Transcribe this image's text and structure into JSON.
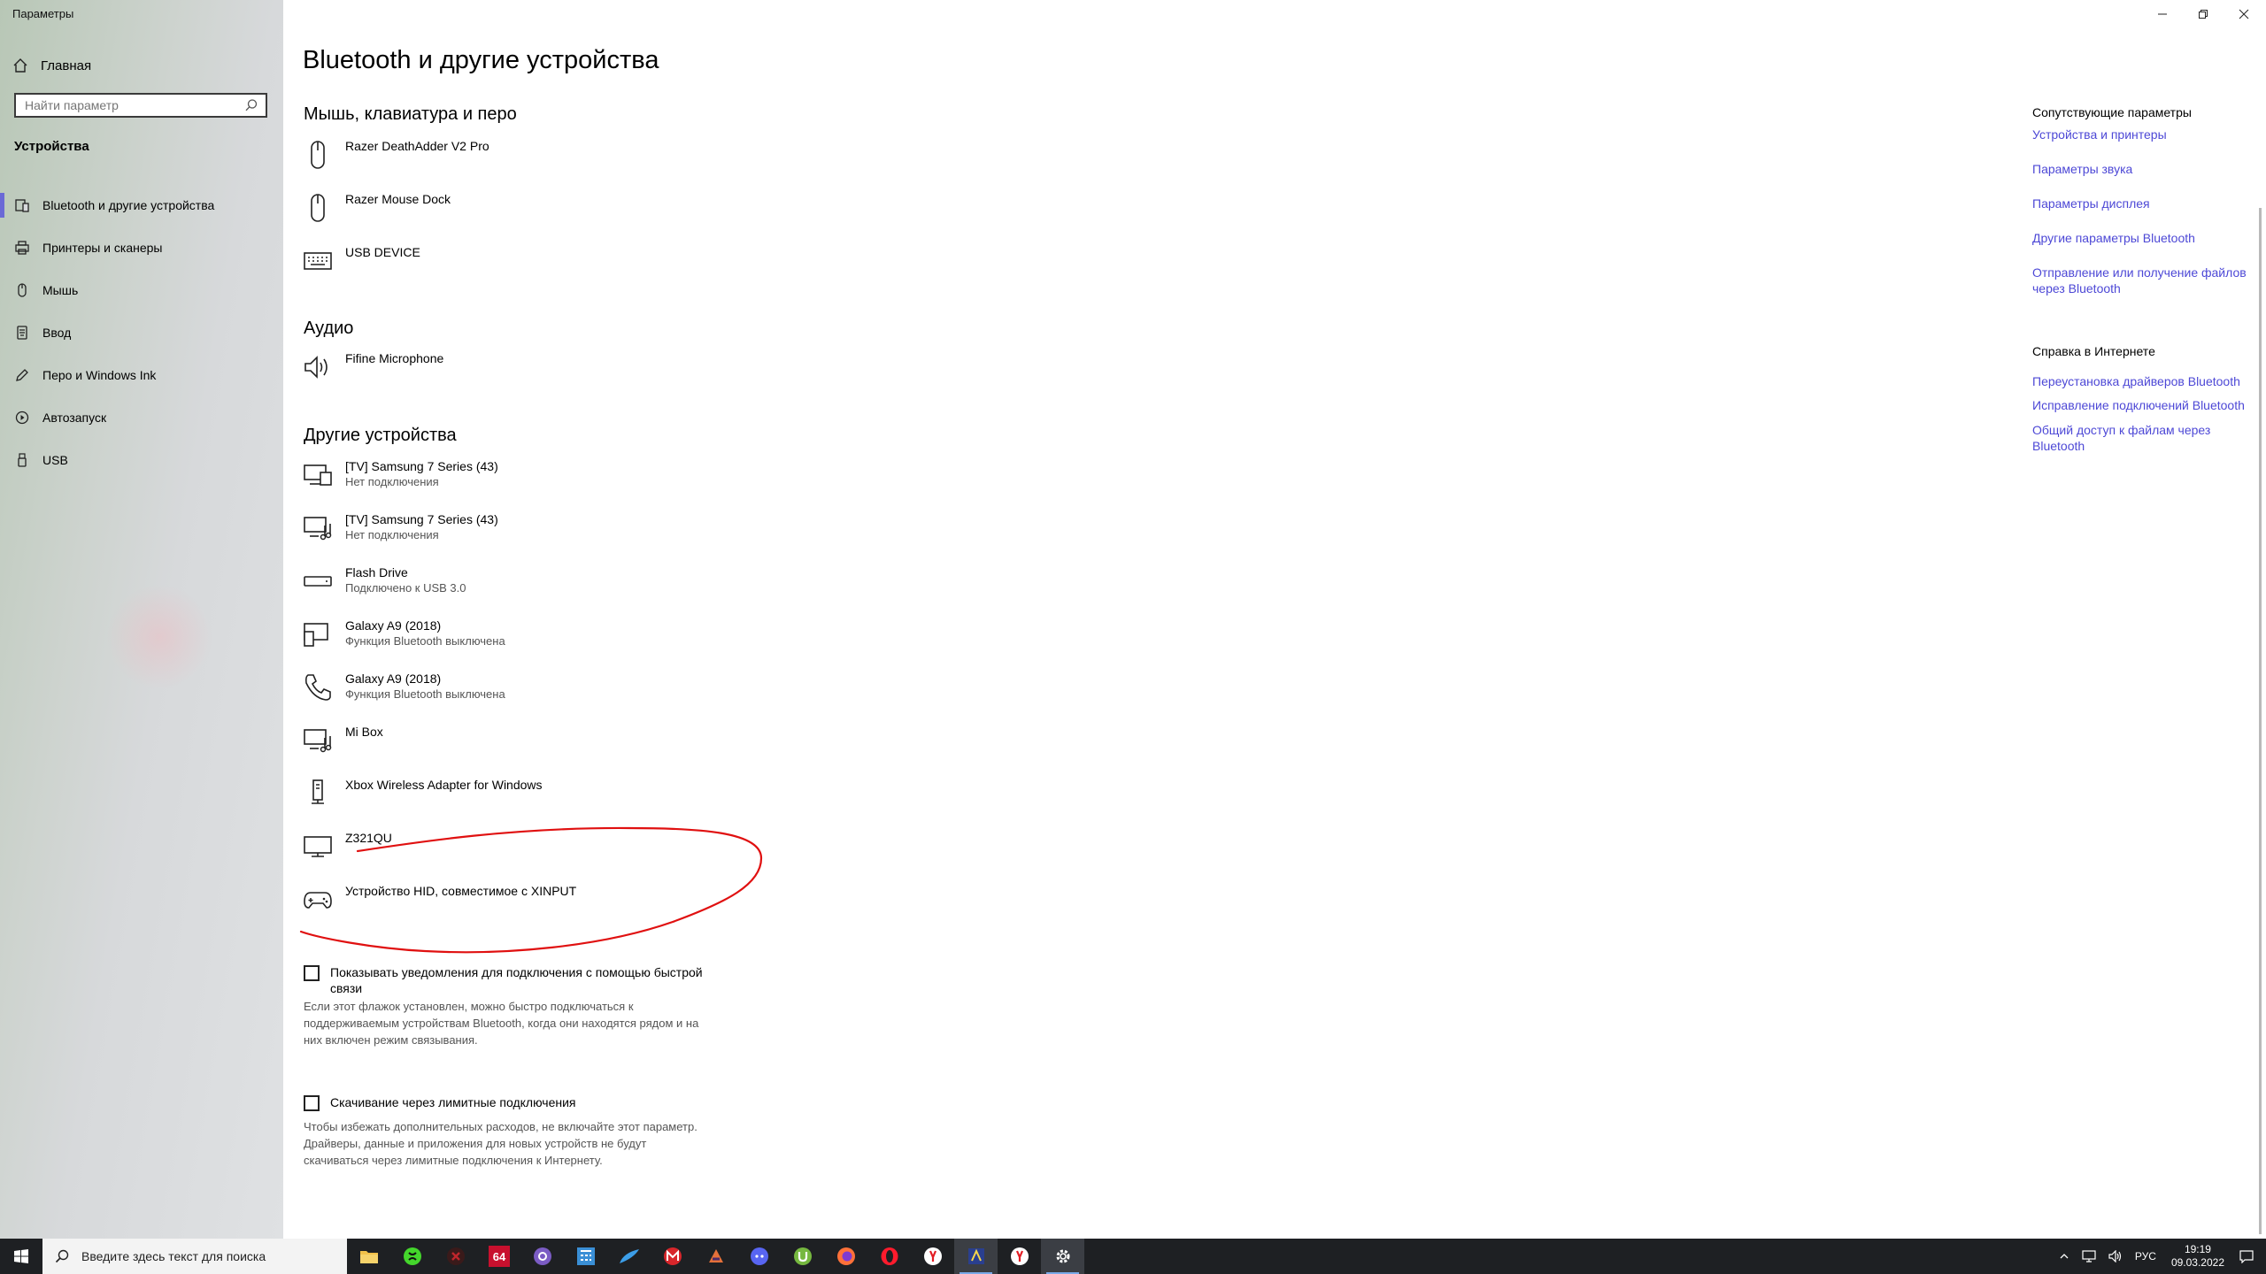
{
  "window": {
    "title": "Параметры"
  },
  "sidebar": {
    "home_label": "Главная",
    "search_placeholder": "Найти параметр",
    "section": "Устройства",
    "items": [
      {
        "label": "Bluetooth и другие устройства",
        "icon": "bluetooth-devices-icon",
        "selected": true
      },
      {
        "label": "Принтеры и сканеры",
        "icon": "printer-icon"
      },
      {
        "label": "Мышь",
        "icon": "mouse-icon"
      },
      {
        "label": "Ввод",
        "icon": "keyboard-icon"
      },
      {
        "label": "Перо и Windows Ink",
        "icon": "pen-icon"
      },
      {
        "label": "Автозапуск",
        "icon": "autoplay-icon"
      },
      {
        "label": "USB",
        "icon": "usb-icon"
      }
    ]
  },
  "main": {
    "title": "Bluetooth и другие устройства",
    "groups": [
      {
        "heading": "Мышь, клавиатура и перо",
        "devices": [
          {
            "name": "Razer DeathAdder V2 Pro",
            "status": "",
            "icon": "mouse-icon"
          },
          {
            "name": "Razer Mouse Dock",
            "status": "",
            "icon": "mouse-icon"
          },
          {
            "name": "USB DEVICE",
            "status": "",
            "icon": "keyboard-icon"
          }
        ]
      },
      {
        "heading": "Аудио",
        "devices": [
          {
            "name": "Fifine Microphone",
            "status": "",
            "icon": "speaker-icon"
          }
        ]
      },
      {
        "heading": "Другие устройства",
        "devices": [
          {
            "name": "[TV] Samsung 7 Series (43)",
            "status": "Нет подключения",
            "icon": "display-device-icon"
          },
          {
            "name": "[TV] Samsung 7 Series (43)",
            "status": "Нет подключения",
            "icon": "media-device-icon"
          },
          {
            "name": "Flash Drive",
            "status": "Подключено к USB 3.0",
            "icon": "drive-icon"
          },
          {
            "name": "Galaxy A9 (2018)",
            "status": "Функция Bluetooth выключена",
            "icon": "phone-device-icon"
          },
          {
            "name": "Galaxy A9 (2018)",
            "status": "Функция Bluetooth выключена",
            "icon": "phone-icon"
          },
          {
            "name": "Mi Box",
            "status": "",
            "icon": "media-device-icon"
          },
          {
            "name": "Xbox Wireless Adapter for Windows",
            "status": "",
            "icon": "adapter-icon"
          },
          {
            "name": "Z321QU",
            "status": "",
            "icon": "monitor-icon"
          },
          {
            "name": "Устройство HID, совместимое с XINPUT",
            "status": "",
            "icon": "gamepad-icon"
          }
        ]
      }
    ],
    "swift_pair": {
      "label": "Показывать уведомления для подключения с помощью быстрой связи",
      "checked": false,
      "description": "Если этот флажок установлен, можно быстро подключаться к поддерживаемым устройствам Bluetooth, когда они находятся рядом и на них включен режим связывания."
    },
    "metered": {
      "label": "Скачивание через лимитные подключения",
      "checked": false,
      "description": "Чтобы избежать дополнительных расходов, не включайте этот параметр. Драйверы, данные и приложения для новых устройств не будут скачиваться через лимитные подключения к Интернету."
    }
  },
  "related": {
    "heading": "Сопутствующие параметры",
    "links": [
      "Устройства и принтеры",
      "Параметры звука",
      "Параметры дисплея",
      "Другие параметры Bluetooth",
      "Отправление или получение файлов через Bluetooth"
    ]
  },
  "help": {
    "heading": "Справка в Интернете",
    "links": [
      "Переустановка драйверов Bluetooth",
      "Исправление подключений Bluetooth",
      "Общий доступ к файлам через Bluetooth"
    ]
  },
  "taskbar": {
    "search_placeholder": "Введите здесь текст для поиска",
    "apps": [
      "file-explorer-icon",
      "razer-icon",
      "x-app-icon",
      "aida64-icon",
      "app-purple-icon",
      "calculator-icon",
      "feather-icon",
      "m-app-icon",
      "game-icon",
      "discord-icon",
      "utorrent-icon",
      "firefox-icon",
      "opera-icon",
      "yandex-icon",
      "app-active-icon",
      "yandex-browser-icon",
      "settings-icon"
    ],
    "aida_label": "64",
    "language": "РУС",
    "time": "19:19",
    "date": "09.03.2022"
  },
  "colors": {
    "accent": "#6b69d6",
    "link": "#4d48d6",
    "annotation": "#e01010"
  }
}
